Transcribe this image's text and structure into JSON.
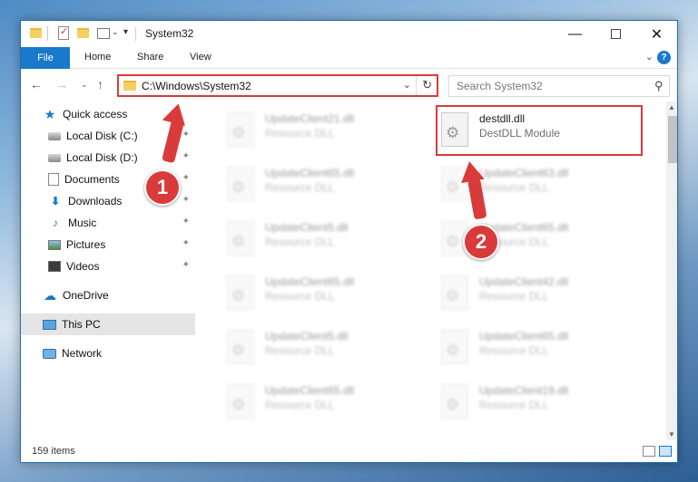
{
  "window": {
    "title": "System32",
    "minimize_glyph": "—",
    "maximize_glyph": "☐",
    "close_glyph": "✕"
  },
  "ribbon": {
    "tabs": [
      "File",
      "Home",
      "Share",
      "View"
    ],
    "collapse_glyph": "⌄",
    "help_glyph": "?"
  },
  "nav": {
    "back_glyph": "←",
    "forward_glyph": "→",
    "recent_glyph": "⌄",
    "up_glyph": "↑"
  },
  "address": {
    "path": "C:\\Windows\\System32",
    "dropdown_glyph": "⌄",
    "refresh_glyph": "↻"
  },
  "search": {
    "placeholder": "Search System32",
    "icon_glyph": "⚲"
  },
  "sidebar": {
    "items": [
      {
        "label": "Quick access",
        "icon": "star-icon",
        "glyph": "★",
        "pinned": false
      },
      {
        "label": "Local Disk (C:)",
        "icon": "disk-icon",
        "glyph": "",
        "pinned": true
      },
      {
        "label": "Local Disk (D:)",
        "icon": "disk-icon",
        "glyph": "",
        "pinned": true
      },
      {
        "label": "Documents",
        "icon": "documents-icon",
        "glyph": "",
        "pinned": true
      },
      {
        "label": "Downloads",
        "icon": "download-icon",
        "glyph": "⬇",
        "pinned": true
      },
      {
        "label": "Music",
        "icon": "music-icon",
        "glyph": "♪",
        "pinned": true
      },
      {
        "label": "Pictures",
        "icon": "pictures-icon",
        "glyph": "",
        "pinned": true
      },
      {
        "label": "Videos",
        "icon": "videos-icon",
        "glyph": "",
        "pinned": true
      },
      {
        "label": "OneDrive",
        "icon": "cloud-icon",
        "glyph": "☁",
        "pinned": false
      },
      {
        "label": "This PC",
        "icon": "computer-icon",
        "glyph": "",
        "pinned": false,
        "selected": true
      },
      {
        "label": "Network",
        "icon": "network-icon",
        "glyph": "",
        "pinned": false
      }
    ],
    "pin_glyph": "✦"
  },
  "files": [
    {
      "name": "UpdateClient21.dll",
      "desc": "Resource DLL",
      "blurred": true
    },
    {
      "name": "destdll.dll",
      "desc": "DestDLL Module",
      "blurred": false,
      "highlighted": true
    },
    {
      "name": "UpdateClient65.dll",
      "desc": "Resource DLL",
      "blurred": true
    },
    {
      "name": "UpdateClient63.dll",
      "desc": "Resource DLL",
      "blurred": true
    },
    {
      "name": "UpdateClient5.dll",
      "desc": "Resource DLL",
      "blurred": true
    },
    {
      "name": "UpdateClient65.dll",
      "desc": "Resource DLL",
      "blurred": true
    },
    {
      "name": "UpdateClient65.dll",
      "desc": "Resource DLL",
      "blurred": true
    },
    {
      "name": "UpdateClient42.dll",
      "desc": "Resource DLL",
      "blurred": true
    },
    {
      "name": "UpdateClient5.dll",
      "desc": "Resource DLL",
      "blurred": true
    },
    {
      "name": "UpdateClient65.dll",
      "desc": "Resource DLL",
      "blurred": true
    },
    {
      "name": "UpdateClient65.dll",
      "desc": "Resource DLL",
      "blurred": true
    },
    {
      "name": "UpdateClient19.dll",
      "desc": "Resource DLL",
      "blurred": true
    }
  ],
  "status": {
    "item_count": "159 items"
  },
  "annotations": [
    {
      "number": "1"
    },
    {
      "number": "2"
    }
  ],
  "colors": {
    "accent": "#1979ca",
    "annotation": "#d93b3b"
  }
}
